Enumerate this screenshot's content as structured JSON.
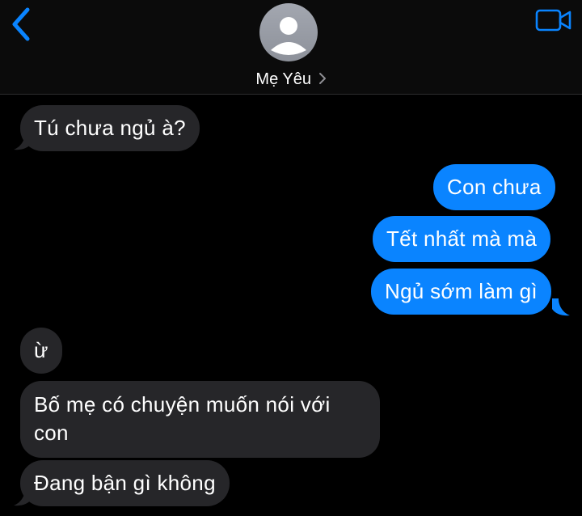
{
  "header": {
    "contact_name": "Mẹ Yêu"
  },
  "icons": {
    "back": "chevron-left-icon",
    "avatar": "person-avatar-icon",
    "name_chevron": "chevron-right-icon",
    "video": "video-camera-icon"
  },
  "colors": {
    "background": "#000000",
    "incoming_bubble": "#262629",
    "outgoing_bubble": "#0a84ff",
    "accent": "#0a84ff"
  },
  "messages": [
    {
      "direction": "incoming",
      "text": "Tú chưa ngủ à?"
    },
    {
      "direction": "outgoing",
      "text": "Con chưa"
    },
    {
      "direction": "outgoing",
      "text": "Tết nhất mà mà"
    },
    {
      "direction": "outgoing",
      "text": "Ngủ sớm làm gì"
    },
    {
      "direction": "incoming",
      "text": "ừ"
    },
    {
      "direction": "incoming",
      "text": "Bố mẹ có chuyện muốn nói với con"
    },
    {
      "direction": "incoming",
      "text": "Đang bận gì không"
    }
  ]
}
